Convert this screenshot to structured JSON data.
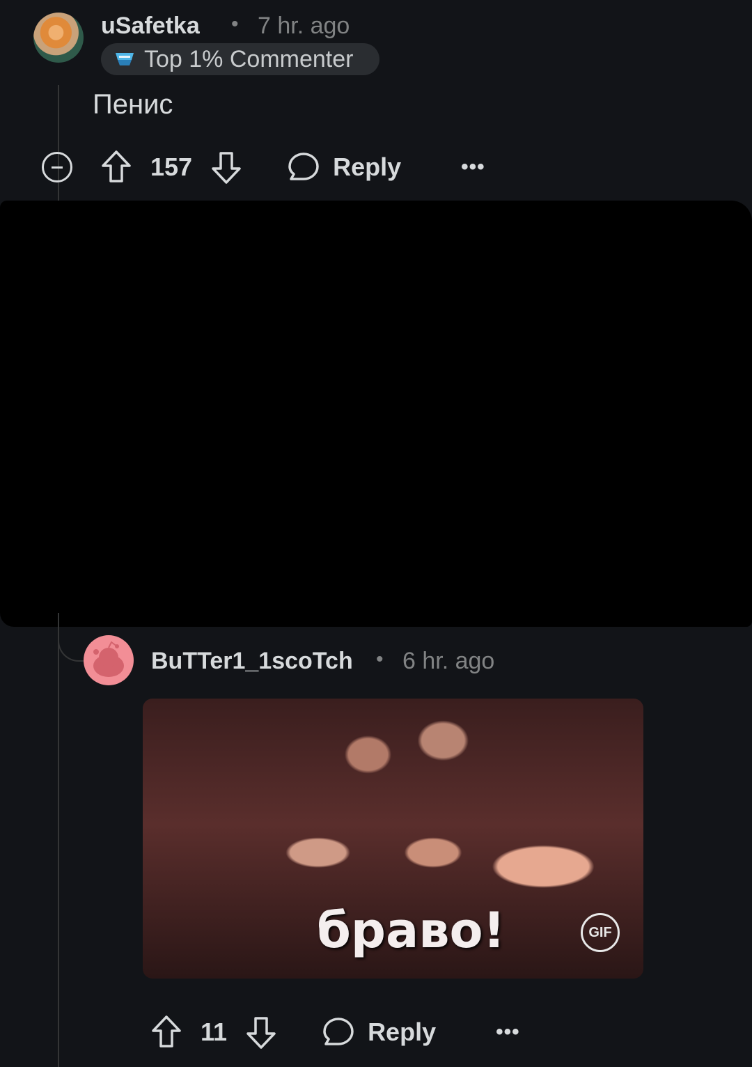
{
  "comment1": {
    "username": "uSafetka",
    "separator": "•",
    "time": "7 hr. ago",
    "flair": "Top 1% Commenter",
    "body": "Пенис",
    "score": "157",
    "reply_label": "Reply",
    "more_label": "•••"
  },
  "comment2": {
    "username": "BuTTer1_1scoTch",
    "separator": "•",
    "time": "6 hr. ago",
    "gif_caption": "браво!",
    "gif_badge": "GIF",
    "score": "11",
    "reply_label": "Reply",
    "more_label": "•••"
  },
  "colors": {
    "background": "#121418",
    "text": "#d7dadc",
    "muted": "#818384",
    "avatar2_bg": "#f28e96"
  }
}
